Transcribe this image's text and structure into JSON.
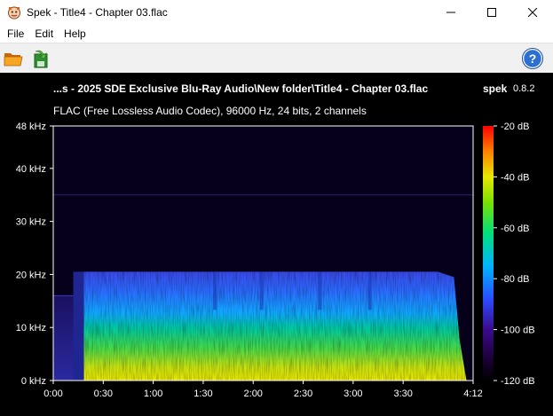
{
  "window": {
    "title": "Spek - Title4 - Chapter 03.flac",
    "app_icon": "spek-icon",
    "controls": [
      "minimize-icon",
      "maximize-icon",
      "close-icon"
    ]
  },
  "menu": {
    "items": [
      {
        "label": "File"
      },
      {
        "label": "Edit"
      },
      {
        "label": "Help"
      }
    ]
  },
  "toolbar": {
    "buttons": [
      {
        "icon": "open-folder-icon"
      },
      {
        "icon": "save-image-icon"
      },
      {
        "icon": "help-icon"
      }
    ]
  },
  "header": {
    "file_path": "...s - 2025 SDE Exclusive Blu-Ray Audio\\New folder\\Title4 - Chapter 03.flac",
    "app_name": "spek",
    "app_version": "0.8.2",
    "file_info": "FLAC (Free Lossless Audio Codec), 96000 Hz, 24 bits, 2 channels"
  },
  "colors": {
    "background": "#000000",
    "text": "#ffffff",
    "palette": [
      "#000000",
      "#1a0033",
      "#3b0a8c",
      "#2a4cff",
      "#00b4ff",
      "#00e07a",
      "#7ae000",
      "#e8e800",
      "#ff8000",
      "#ff0000"
    ]
  },
  "chart_data": {
    "type": "heatmap",
    "title": "",
    "xlabel": "",
    "ylabel": "",
    "x_ticks": [
      "0:00",
      "0:30",
      "1:00",
      "1:30",
      "2:00",
      "2:30",
      "3:00",
      "3:30",
      "4:12"
    ],
    "x_tick_seconds": [
      0,
      30,
      60,
      90,
      120,
      150,
      180,
      210,
      252
    ],
    "xlim_seconds": [
      0,
      252
    ],
    "y_ticks": [
      "0 kHz",
      "10 kHz",
      "20 kHz",
      "30 kHz",
      "40 kHz",
      "48 kHz"
    ],
    "y_tick_khz": [
      0,
      10,
      20,
      30,
      40,
      48
    ],
    "ylim_khz": [
      0,
      48
    ],
    "colorbar_ticks": [
      "-20 dB",
      "-40 dB",
      "-60 dB",
      "-80 dB",
      "-100 dB",
      "-120 dB"
    ],
    "colorbar_db": [
      -20,
      -40,
      -60,
      -80,
      -100,
      -120
    ],
    "colorbar_range_db": [
      -120,
      -20
    ],
    "content": {
      "music_start_s": 12,
      "music_end_s": 248,
      "lowpass_khz": 20.5,
      "hum_line_khz": 35
    }
  }
}
